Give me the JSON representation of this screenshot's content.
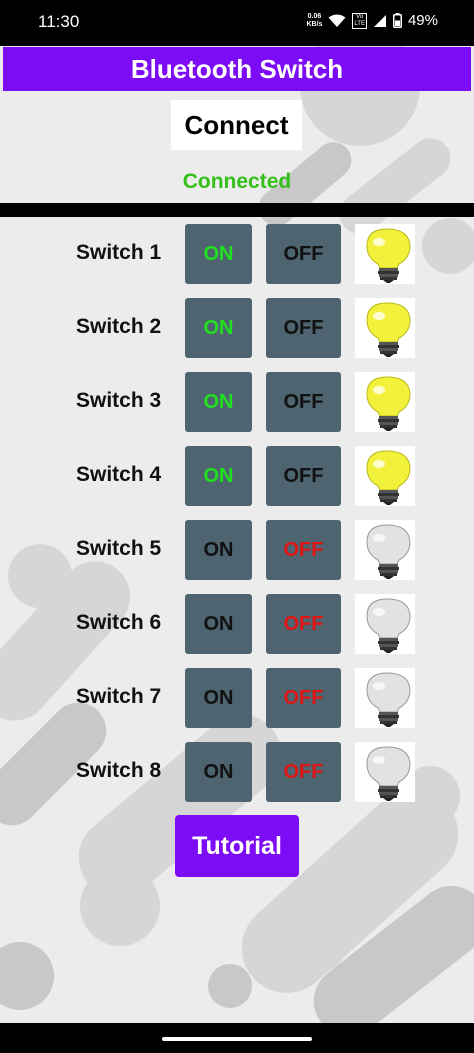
{
  "status_bar": {
    "time": "11:30",
    "net_speed_value": "0.06",
    "net_speed_unit": "KB/s",
    "volte_top": "Vo",
    "volte_bottom": "LTE",
    "battery_percent": "49%"
  },
  "app": {
    "title": "Bluetooth Switch",
    "connect_label": "Connect",
    "status": "Connected",
    "tutorial_label": "Tutorial"
  },
  "switches": [
    {
      "label": "Switch 1",
      "on_label": "ON",
      "off_label": "OFF",
      "state": "on"
    },
    {
      "label": "Switch 2",
      "on_label": "ON",
      "off_label": "OFF",
      "state": "on"
    },
    {
      "label": "Switch 3",
      "on_label": "ON",
      "off_label": "OFF",
      "state": "on"
    },
    {
      "label": "Switch 4",
      "on_label": "ON",
      "off_label": "OFF",
      "state": "on"
    },
    {
      "label": "Switch 5",
      "on_label": "ON",
      "off_label": "OFF",
      "state": "off"
    },
    {
      "label": "Switch 6",
      "on_label": "ON",
      "off_label": "OFF",
      "state": "off"
    },
    {
      "label": "Switch 7",
      "on_label": "ON",
      "off_label": "OFF",
      "state": "off"
    },
    {
      "label": "Switch 8",
      "on_label": "ON",
      "off_label": "OFF",
      "state": "off"
    }
  ],
  "colors": {
    "accent": "#7c0bf6",
    "status_connected": "#33c01a",
    "on_active": "#1fe11f",
    "off_active": "#e11414",
    "button_bg": "#4e6470",
    "bulb_lit": "#f2f23c",
    "bulb_unlit": "#e2e2e2"
  }
}
